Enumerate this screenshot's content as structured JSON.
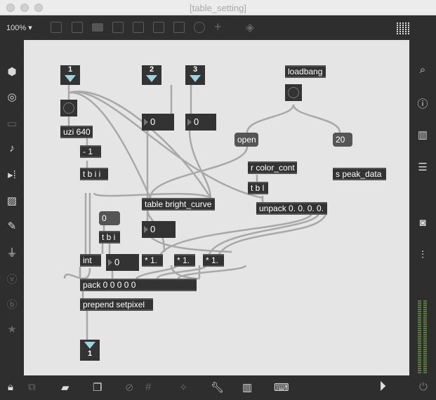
{
  "window": {
    "title": "[table_setting]"
  },
  "toolbar": {
    "zoom": "100%"
  },
  "patch": {
    "inlet1": "1",
    "inlet2": "2",
    "inlet3": "3",
    "outlet1": "1",
    "uzi": "uzi 640",
    "minus": "- 1",
    "tbii": "t b i i",
    "num2": "0",
    "num3": "0",
    "loadbang": "loadbang",
    "open": "open",
    "twenty": "20",
    "r_color": "r color_cont",
    "tbl": "t b l",
    "s_peak": "s peak_data",
    "table": "table bright_curve",
    "unpack": "unpack 0. 0. 0. 0.",
    "msg0": "0",
    "tbi": "t b i",
    "numTable": "0",
    "int": "int",
    "numInt": "0",
    "mul1": "* 1.",
    "mul2": "* 1.",
    "mul3": "* 1.",
    "pack": "pack 0 0 0 0 0",
    "prepend": "prepend setpixel"
  }
}
